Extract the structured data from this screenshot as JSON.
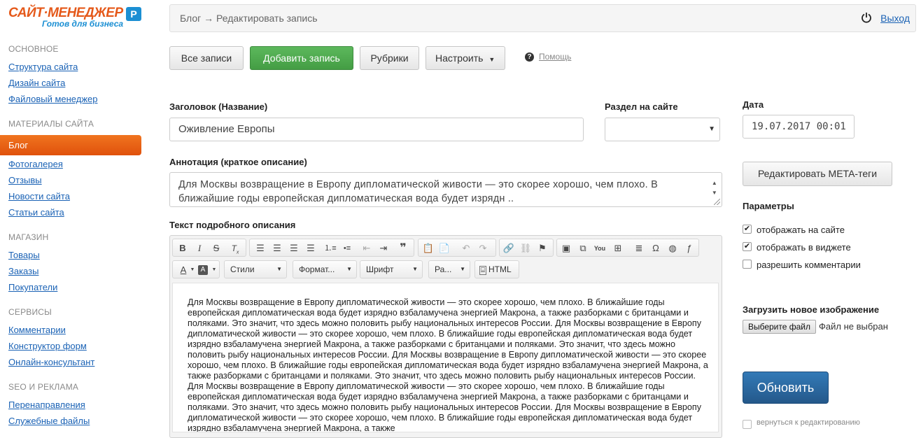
{
  "logo": {
    "main": "САЙТ·МЕНЕДЖЕР",
    "sub": "Готов для бизнеса",
    "badge": "P"
  },
  "sidebar": {
    "sections": [
      {
        "title": "ОСНОВНОЕ",
        "items": [
          "Структура сайта",
          "Дизайн сайта",
          "Файловый менеджер"
        ]
      },
      {
        "title": "МАТЕРИАЛЫ САЙТА",
        "items": [
          "Блог",
          "Фотогалерея",
          "Отзывы",
          "Новости сайта",
          "Статьи сайта"
        ]
      },
      {
        "title": "МАГАЗИН",
        "items": [
          "Товары",
          "Заказы",
          "Покупатели"
        ]
      },
      {
        "title": "СЕРВИСЫ",
        "items": [
          "Комментарии",
          "Конструктор форм",
          "Онлайн-консультант"
        ]
      },
      {
        "title": "SEO И РЕКЛАМА",
        "items": [
          "Перенаправления",
          "Служебные файлы"
        ]
      }
    ],
    "active": "Блог"
  },
  "topbar": {
    "breadcrumb": "Блог → Редактировать запись",
    "logout": "Выход"
  },
  "actions": {
    "all": "Все записи",
    "add": "Добавить запись",
    "categories": "Рубрики",
    "configure": "Настроить",
    "help": "Помощь"
  },
  "form": {
    "title_label": "Заголовок (Название)",
    "title_value": "Оживление Европы",
    "section_label": "Раздел на сайте",
    "section_value": "",
    "date_label": "Дата",
    "date_value": "19.07.2017 00:01",
    "annotation_label": "Аннотация (краткое описание)",
    "annotation_value": "Для Москвы возвращение в Европу дипломатической живости — это скорее хорошо, чем плохо. В ближайшие годы европейская дипломатическая вода будет изрядн ..",
    "body_label": "Текст подробного описания",
    "body_text": "Для Москвы возвращение в Европу дипломатической живости — это скорее хорошо, чем плохо. В ближайшие годы европейская дипломатическая вода будет изрядно взбаламучена энергией Макрона, а также разборками с британцами и поляками. Это значит, что здесь можно половить рыбу национальных интересов России. Для Москвы возвращение в Европу дипломатической живости — это скорее хорошо, чем плохо. В ближайшие годы европейская дипломатическая вода будет изрядно взбаламучена энергией Макрона, а также разборками с британцами и поляками. Это значит, что здесь можно половить рыбу национальных интересов России. Для Москвы возвращение в Европу дипломатической живости — это скорее хорошо, чем плохо. В ближайшие годы европейская дипломатическая вода будет изрядно взбаламучена энергией Макрона, а также разборками с британцами и поляками. Это значит, что здесь можно половить рыбу национальных интересов России. Для Москвы возвращение в Европу дипломатической живости — это скорее хорошо, чем плохо. В ближайшие годы европейская дипломатическая вода будет изрядно взбаламучена энергией Макрона, а также разборками с британцами и поляками. Это значит, что здесь можно половить рыбу национальных интересов России. Для Москвы возвращение в Европу дипломатической живости — это скорее хорошо, чем плохо. В ближайшие годы европейская дипломатическая вода будет изрядно взбаламучена энергией Макрона, а также"
  },
  "editor": {
    "styles": "Стили",
    "format": "Формат...",
    "font": "Шрифт",
    "size": "Ра...",
    "html": "HTML"
  },
  "right": {
    "meta_button": "Редактировать META-теги",
    "params_title": "Параметры",
    "params": [
      {
        "label": "отображать на сайте",
        "checked": true
      },
      {
        "label": "отображать в виджете",
        "checked": true
      },
      {
        "label": "разрешить комментарии",
        "checked": false
      }
    ],
    "upload_title": "Загрузить новое изображение",
    "file_button": "Выберите файл",
    "file_status": "Файл не выбран",
    "update_button": "Обновить",
    "return_label": "вернуться к редактированию"
  }
}
